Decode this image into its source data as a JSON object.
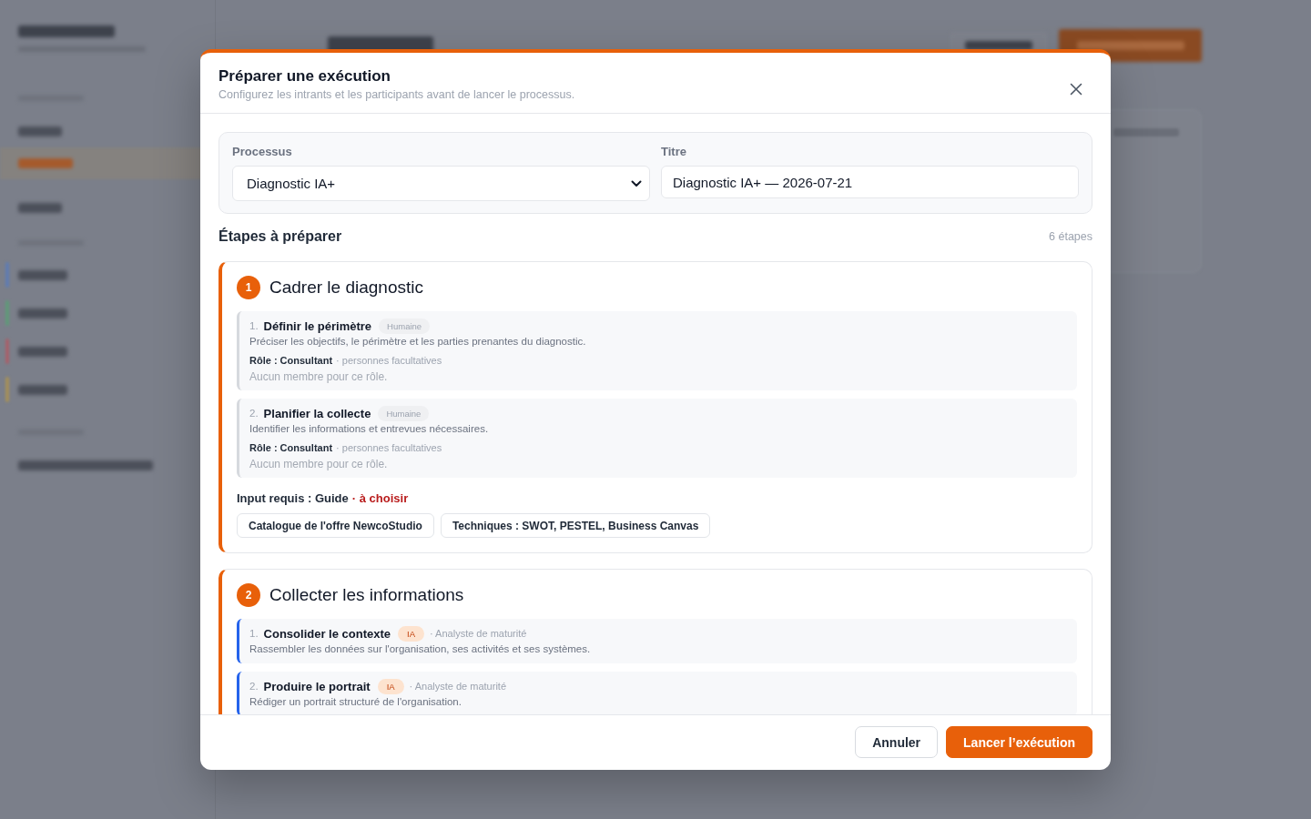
{
  "dialog": {
    "title": "Préparer une exécution",
    "subtitle": "Configurez les intrants et les participants avant de lancer le processus."
  },
  "form": {
    "fields": [
      {
        "kind": "select",
        "label": "Processus",
        "value": "Diagnostic IA+"
      },
      {
        "kind": "text",
        "label": "Titre",
        "value": "Diagnostic IA+ — 2026-07-21"
      }
    ]
  },
  "steps_header": {
    "title": "Étapes à préparer",
    "count": "6 étapes"
  },
  "steps": [
    {
      "number": "1",
      "title": "Cadrer le diagnostic",
      "tasks": [
        {
          "kind": "human",
          "number": "1.",
          "title": "Définir le périmètre",
          "badge": "Humaine",
          "description": "Préciser les objectifs, le périmètre et les parties prenantes du diagnostic.",
          "role": "Rôle : Consultant",
          "role_note": "· personnes facultatives",
          "members_note": "Aucun membre pour ce rôle."
        },
        {
          "kind": "human",
          "number": "2.",
          "title": "Planifier la collecte",
          "badge": "Humaine",
          "description": "Identifier les informations et entrevues nécessaires.",
          "role": "Rôle : Consultant",
          "role_note": "· personnes facultatives",
          "members_note": "Aucun membre pour ce rôle."
        }
      ],
      "input": {
        "label": "Input requis : Guide",
        "status": "· à choisir",
        "options": [
          "Catalogue de l'offre NewcoStudio",
          "Techniques : SWOT, PESTEL, Business Canvas"
        ]
      }
    },
    {
      "number": "2",
      "title": "Collecter les informations",
      "tasks": [
        {
          "kind": "ai",
          "number": "1.",
          "title": "Consolider le contexte",
          "badge": "IA",
          "agent": "· Analyste de maturité",
          "description": "Rassembler les données sur l'organisation, ses activités et ses systèmes."
        },
        {
          "kind": "ai",
          "number": "2.",
          "title": "Produire le portrait",
          "badge": "IA",
          "agent": "· Analyste de maturité",
          "description": "Rédiger un portrait structuré de l'organisation."
        }
      ]
    }
  ],
  "footer": {
    "buttons": [
      {
        "kind": "secondary",
        "label": "Annuler"
      },
      {
        "kind": "primary",
        "label": "Lancer l’exécution"
      }
    ]
  }
}
